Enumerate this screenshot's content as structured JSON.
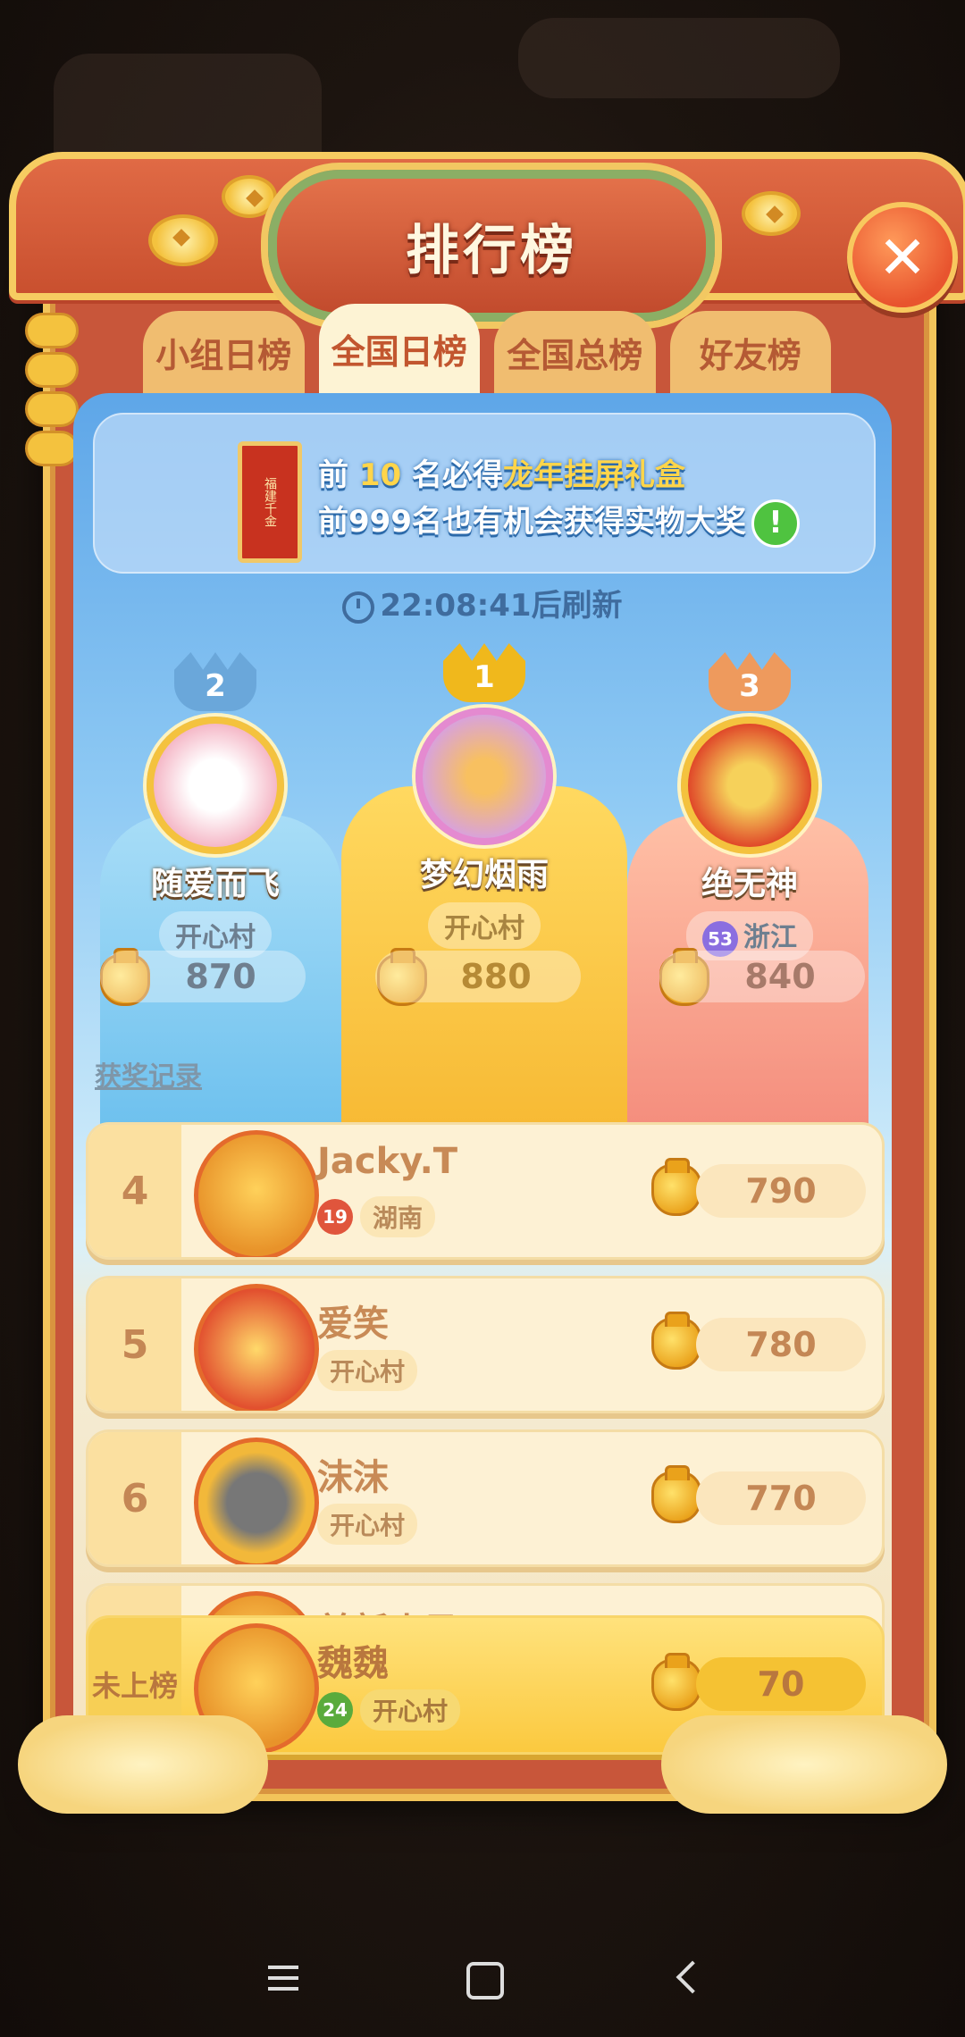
{
  "header": {
    "title": "排行榜",
    "close_glyph": "✕"
  },
  "tabs": [
    {
      "label": "小组日榜",
      "active": false
    },
    {
      "label": "全国日榜",
      "active": true
    },
    {
      "label": "全国总榜",
      "active": false
    },
    {
      "label": "好友榜",
      "active": false
    }
  ],
  "notice": {
    "prize_image_text": "福建千金",
    "line1_prefix": "前",
    "line1_rank": "10",
    "line1_mid": "名必得",
    "line1_prize": "龙年挂屏礼盒",
    "line2": "前999名也有机会获得实物大奖",
    "info_glyph": "!"
  },
  "timer": {
    "time": "22:08:41",
    "suffix": "后刷新"
  },
  "podium": {
    "first": {
      "rank": "1",
      "name": "梦幻烟雨",
      "location": "开心村",
      "score": "880"
    },
    "second": {
      "rank": "2",
      "name": "随爱而飞",
      "location": "开心村",
      "score": "870"
    },
    "third": {
      "rank": "3",
      "name": "绝无神",
      "level": "53",
      "location": "浙江",
      "score": "840"
    }
  },
  "award_record_link": "获奖记录",
  "list": [
    {
      "rank": "4",
      "name": "Jacky.T",
      "level": "19",
      "location": "湖南",
      "score": "790"
    },
    {
      "rank": "5",
      "name": "爱笑",
      "location": "开心村",
      "score": "780"
    },
    {
      "rank": "6",
      "name": "沫沫",
      "location": "开心村",
      "score": "770"
    },
    {
      "name": "羊新小马"
    }
  ],
  "self": {
    "rank": "未上榜",
    "name": "魏魏",
    "level": "24",
    "location": "开心村",
    "score": "70"
  },
  "colors": {
    "frame": "#c8563a",
    "gold": "#f4c23e",
    "panel_top": "#5ea6e8",
    "self_row": "#fbc93f"
  },
  "icons": [
    "close-icon",
    "clock-icon",
    "coin-bag-icon",
    "crown-icon",
    "menu-icon",
    "home-icon",
    "back-icon"
  ]
}
